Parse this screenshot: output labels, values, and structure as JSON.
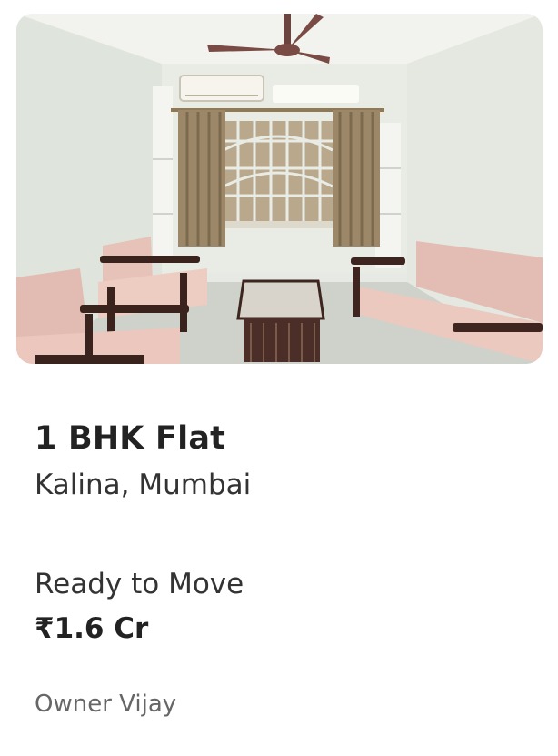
{
  "listing": {
    "title": "1 BHK Flat",
    "location": "Kalina, Mumbai",
    "status": "Ready to Move",
    "price": "₹1.6 Cr",
    "owner": "Owner Vijay"
  }
}
